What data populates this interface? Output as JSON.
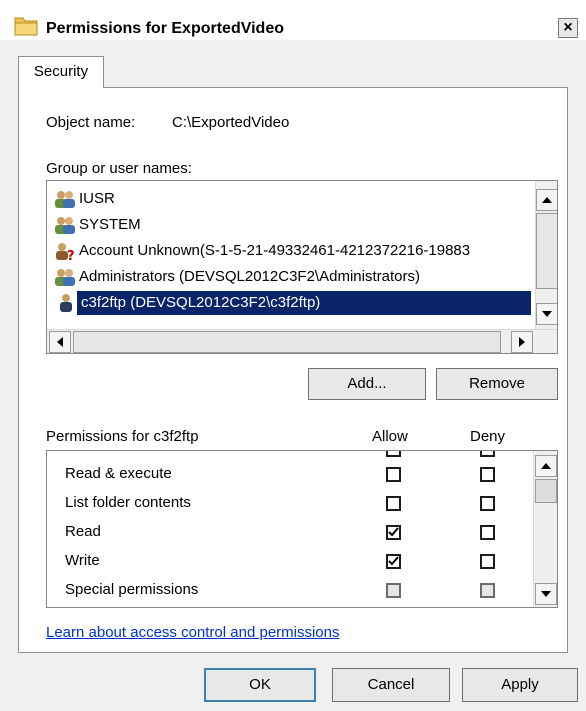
{
  "window": {
    "title": "Permissions for ExportedVideo",
    "close_glyph": "×"
  },
  "tabs": [
    {
      "label": "Security",
      "active": true
    }
  ],
  "object": {
    "label": "Object name:",
    "value": "C:\\ExportedVideo"
  },
  "group": {
    "label": "Group or user names:",
    "items": [
      {
        "name": "IUSR",
        "icon": "users-icon"
      },
      {
        "name": "SYSTEM",
        "icon": "users-icon"
      },
      {
        "name": "Account Unknown(S-1-5-21-49332461-4212372216-19883",
        "icon": "unknown-user-icon"
      },
      {
        "name": "Administrators (DEVSQL2012C3F2\\Administrators)",
        "icon": "users-icon"
      },
      {
        "name": "c3f2ftp (DEVSQL2012C3F2\\c3f2ftp)",
        "icon": "user-icon",
        "selected": true
      }
    ]
  },
  "buttons": {
    "add": "Add...",
    "remove": "Remove",
    "ok": "OK",
    "cancel": "Cancel",
    "apply": "Apply"
  },
  "permissions": {
    "label": "Permissions for c3f2ftp",
    "allow_header": "Allow",
    "deny_header": "Deny",
    "rows": [
      {
        "name": "Read & execute",
        "allow": false,
        "deny": false
      },
      {
        "name": "List folder contents",
        "allow": false,
        "deny": false
      },
      {
        "name": "Read",
        "allow": true,
        "deny": false
      },
      {
        "name": "Write",
        "allow": true,
        "deny": false
      },
      {
        "name": "Special permissions",
        "allow": false,
        "deny": false,
        "disabled": true
      }
    ]
  },
  "link": {
    "text": "Learn about access control and permissions"
  },
  "colors": {
    "selection": "#0a246a",
    "link": "#0033cc",
    "folder": "#f2c14e"
  }
}
